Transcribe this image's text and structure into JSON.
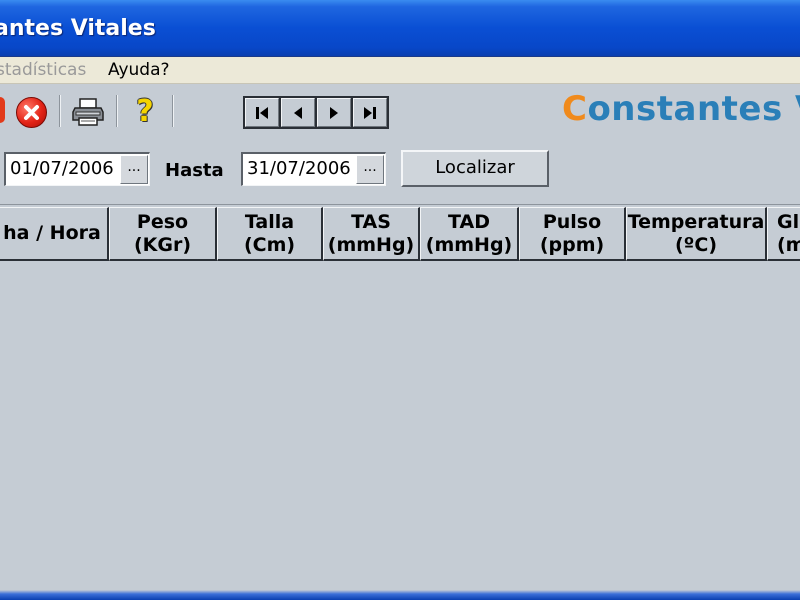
{
  "window": {
    "title": "antes Vitales"
  },
  "menu": {
    "items": [
      {
        "label": "stadísticas",
        "enabled": false
      },
      {
        "label": "Ayuda?",
        "enabled": true
      }
    ]
  },
  "toolbar": {
    "icons": [
      "record-icon",
      "cancel-icon",
      "printer-icon",
      "help-icon"
    ],
    "nav": [
      {
        "name": "first-record-icon"
      },
      {
        "name": "previous-record-icon"
      },
      {
        "name": "next-record-icon"
      },
      {
        "name": "last-record-icon"
      }
    ],
    "brand_first": "C",
    "brand_rest": "onstantes V",
    "colors": {
      "brand_orange": "#f08a1c",
      "brand_blue": "#2a7fb8"
    }
  },
  "filter": {
    "from_value": "01/07/2006",
    "picker_label": "...",
    "hasta_label": "Hasta",
    "to_value": "31/07/2006",
    "search_label": "Localizar"
  },
  "grid": {
    "columns": [
      {
        "line1": "ha / Hora",
        "line2": ""
      },
      {
        "line1": "Peso",
        "line2": "(KGr)"
      },
      {
        "line1": "Talla",
        "line2": "(Cm)"
      },
      {
        "line1": "TAS",
        "line2": "(mmHg)"
      },
      {
        "line1": "TAD",
        "line2": "(mmHg)"
      },
      {
        "line1": "Pulso",
        "line2": "(ppm)"
      },
      {
        "line1": "Temperatura",
        "line2": "(ºC)"
      },
      {
        "line1": "Gl",
        "line2": "(m"
      }
    ],
    "rows": []
  }
}
